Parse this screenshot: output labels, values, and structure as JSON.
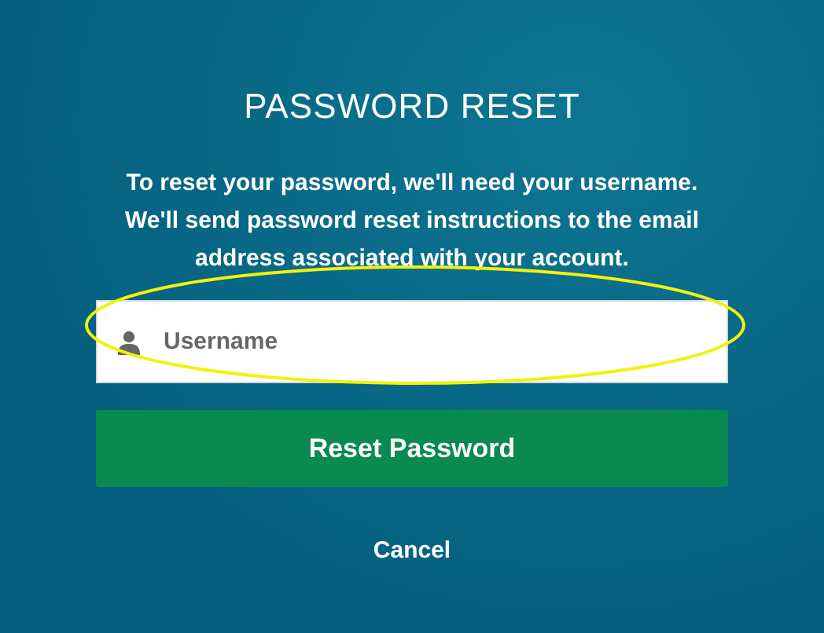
{
  "title": "PASSWORD RESET",
  "instructions": "To reset your password, we'll need your username. We'll send password reset instructions to the email address associated with your account.",
  "username_field": {
    "placeholder": "Username",
    "highlighted": true
  },
  "submit_button": "Reset Password",
  "cancel_link": "Cancel"
}
